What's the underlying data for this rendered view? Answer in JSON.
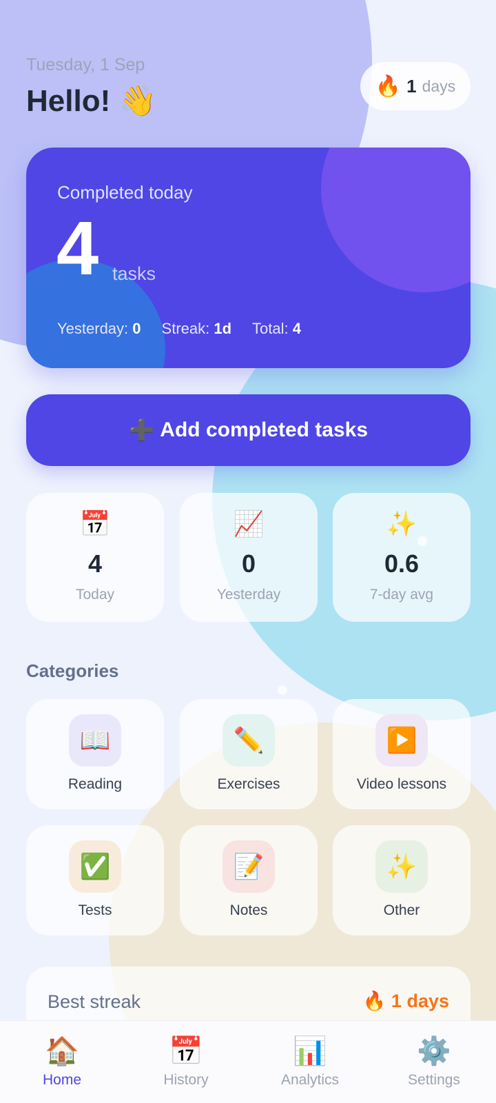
{
  "header": {
    "date": "Tuesday, 1 Sep",
    "greeting": "Hello! 👋",
    "streak": {
      "icon": "🔥",
      "value": "1",
      "unit": "days"
    }
  },
  "hero": {
    "label": "Completed today",
    "count": "4",
    "unit": "tasks",
    "yesterday_label": "Yesterday:",
    "yesterday_value": "0",
    "streak_label": "Streak:",
    "streak_value": "1d",
    "total_label": "Total:",
    "total_value": "4"
  },
  "add_button": {
    "icon": "➕",
    "label": "Add completed tasks"
  },
  "stats": [
    {
      "icon": "📅",
      "value": "4",
      "label": "Today"
    },
    {
      "icon": "📈",
      "value": "0",
      "label": "Yesterday"
    },
    {
      "icon": "✨",
      "value": "0.6",
      "label": "7-day avg"
    }
  ],
  "categories": {
    "title": "Categories",
    "items": [
      {
        "icon": "📖",
        "label": "Reading",
        "bg": "#e9e8fb"
      },
      {
        "icon": "✏️",
        "label": "Exercises",
        "bg": "#e3f3f0"
      },
      {
        "icon": "▶️",
        "label": "Video lessons",
        "bg": "#efe6f6"
      },
      {
        "icon": "✅",
        "label": "Tests",
        "bg": "#f8ebdc"
      },
      {
        "icon": "📝",
        "label": "Notes",
        "bg": "#f8e3e1"
      },
      {
        "icon": "✨",
        "label": "Other",
        "bg": "#e6f1e3"
      }
    ]
  },
  "best_streak": {
    "label": "Best streak",
    "value": "🔥 1 days"
  },
  "nav": [
    {
      "icon": "🏠",
      "label": "Home"
    },
    {
      "icon": "📅",
      "label": "History"
    },
    {
      "icon": "📊",
      "label": "Analytics"
    },
    {
      "icon": "⚙️",
      "label": "Settings"
    }
  ]
}
